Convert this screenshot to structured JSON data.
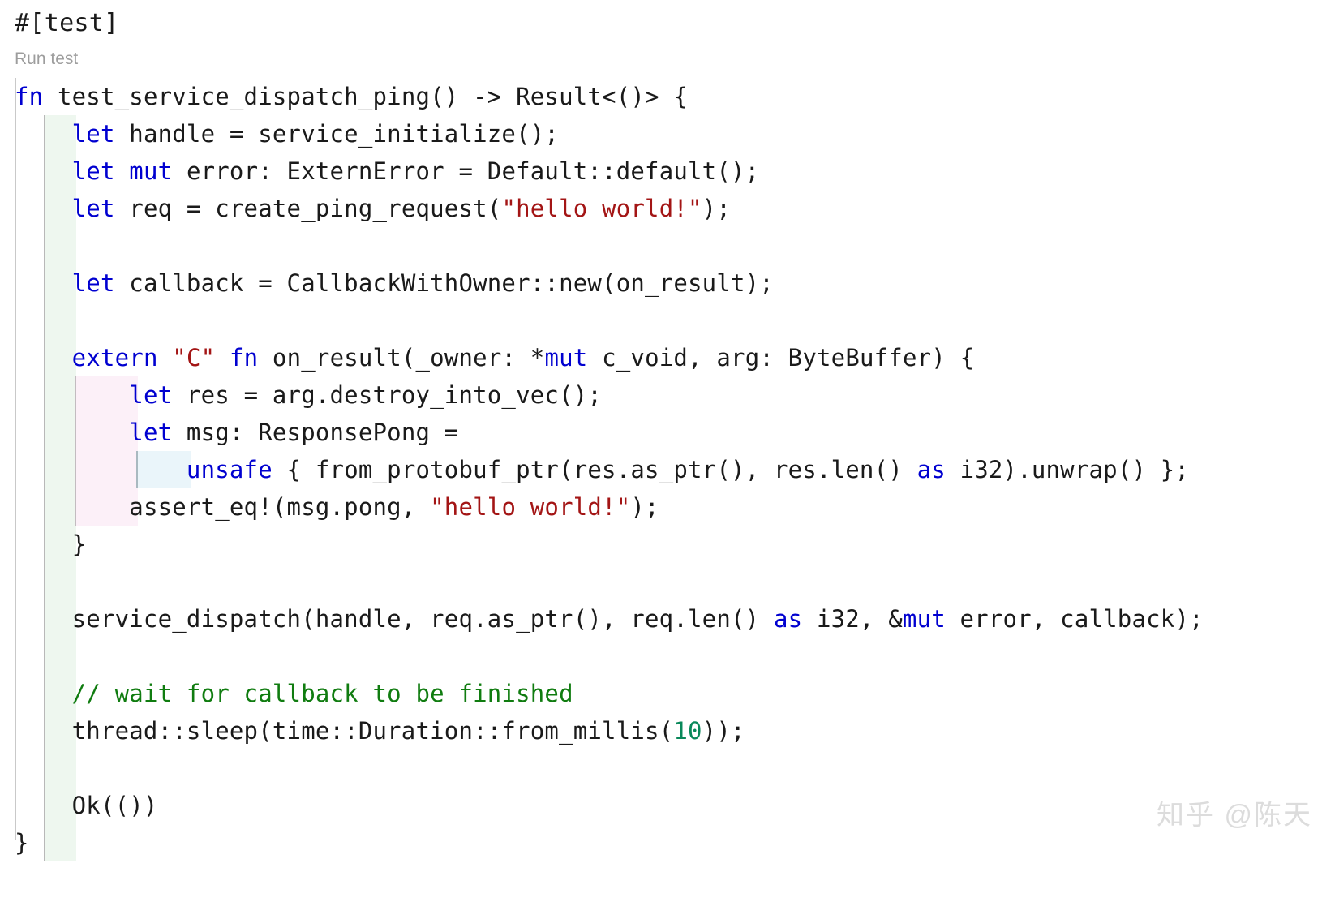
{
  "editor": {
    "attribute": "#[test]",
    "codelens": "Run test",
    "language": "rust"
  },
  "colors": {
    "keyword": "#0000d0",
    "string": "#a31515",
    "comment": "#107c10",
    "number": "#09885a",
    "text": "#1a1a1a",
    "codelens": "#9d9d9d",
    "scope_level1_bg": "#eef7ef",
    "scope_level2_bg": "#fcf0f8",
    "scope_level3_bg": "#eaf5fa",
    "watermark": "#dcdcdc",
    "background": "#ffffff"
  },
  "code": {
    "lines": [
      {
        "id": "line-fn-signature",
        "tokens": [
          {
            "t": "fn",
            "c": "kw"
          },
          {
            "t": " test_service_dispatch_ping() -> Result<()> {",
            "c": "plain"
          }
        ]
      },
      {
        "id": "line-let-handle",
        "tokens": [
          {
            "t": "    ",
            "c": "plain"
          },
          {
            "t": "let",
            "c": "kw"
          },
          {
            "t": " handle = service_initialize();",
            "c": "plain"
          }
        ]
      },
      {
        "id": "line-let-mut-error",
        "tokens": [
          {
            "t": "    ",
            "c": "plain"
          },
          {
            "t": "let",
            "c": "kw"
          },
          {
            "t": " ",
            "c": "plain"
          },
          {
            "t": "mut",
            "c": "kw"
          },
          {
            "t": " error: ExternError = Default::default();",
            "c": "plain"
          }
        ]
      },
      {
        "id": "line-let-req",
        "tokens": [
          {
            "t": "    ",
            "c": "plain"
          },
          {
            "t": "let",
            "c": "kw"
          },
          {
            "t": " req = create_ping_request(",
            "c": "plain"
          },
          {
            "t": "\"hello world!\"",
            "c": "str"
          },
          {
            "t": ");",
            "c": "plain"
          }
        ]
      },
      {
        "id": "line-blank-1",
        "tokens": [
          {
            "t": "",
            "c": "plain"
          }
        ]
      },
      {
        "id": "line-let-callback",
        "tokens": [
          {
            "t": "    ",
            "c": "plain"
          },
          {
            "t": "let",
            "c": "kw"
          },
          {
            "t": " callback = CallbackWithOwner::new(on_result);",
            "c": "plain"
          }
        ]
      },
      {
        "id": "line-blank-2",
        "tokens": [
          {
            "t": "",
            "c": "plain"
          }
        ]
      },
      {
        "id": "line-extern-fn",
        "tokens": [
          {
            "t": "    ",
            "c": "plain"
          },
          {
            "t": "extern",
            "c": "kw"
          },
          {
            "t": " ",
            "c": "plain"
          },
          {
            "t": "\"C\"",
            "c": "str"
          },
          {
            "t": " ",
            "c": "plain"
          },
          {
            "t": "fn",
            "c": "kw"
          },
          {
            "t": " on_result(_owner: *",
            "c": "plain"
          },
          {
            "t": "mut",
            "c": "kw"
          },
          {
            "t": " c_void, arg: ByteBuffer) {",
            "c": "plain"
          }
        ]
      },
      {
        "id": "line-let-res",
        "tokens": [
          {
            "t": "        ",
            "c": "plain"
          },
          {
            "t": "let",
            "c": "kw"
          },
          {
            "t": " res = arg.destroy_into_vec();",
            "c": "plain"
          }
        ]
      },
      {
        "id": "line-let-msg",
        "tokens": [
          {
            "t": "        ",
            "c": "plain"
          },
          {
            "t": "let",
            "c": "kw"
          },
          {
            "t": " msg: ResponsePong =",
            "c": "plain"
          }
        ]
      },
      {
        "id": "line-unsafe-block",
        "tokens": [
          {
            "t": "            ",
            "c": "plain"
          },
          {
            "t": "unsafe",
            "c": "kw"
          },
          {
            "t": " { from_protobuf_ptr(res.as_ptr(), res.len() ",
            "c": "plain"
          },
          {
            "t": "as",
            "c": "kw"
          },
          {
            "t": " i32).unwrap() };",
            "c": "plain"
          }
        ]
      },
      {
        "id": "line-assert-eq",
        "tokens": [
          {
            "t": "        ",
            "c": "plain"
          },
          {
            "t": "assert_eq!(msg.pong, ",
            "c": "plain"
          },
          {
            "t": "\"hello world!\"",
            "c": "str"
          },
          {
            "t": ");",
            "c": "plain"
          }
        ]
      },
      {
        "id": "line-close-extern",
        "tokens": [
          {
            "t": "    }",
            "c": "plain"
          }
        ]
      },
      {
        "id": "line-blank-3",
        "tokens": [
          {
            "t": "",
            "c": "plain"
          }
        ]
      },
      {
        "id": "line-service-dispatch",
        "tokens": [
          {
            "t": "    service_dispatch(handle, req.as_ptr(), req.len() ",
            "c": "plain"
          },
          {
            "t": "as",
            "c": "kw"
          },
          {
            "t": " i32, &",
            "c": "plain"
          },
          {
            "t": "mut",
            "c": "kw"
          },
          {
            "t": " error, callback);",
            "c": "plain"
          }
        ]
      },
      {
        "id": "line-blank-4",
        "tokens": [
          {
            "t": "",
            "c": "plain"
          }
        ]
      },
      {
        "id": "line-comment-wait",
        "tokens": [
          {
            "t": "    ",
            "c": "plain"
          },
          {
            "t": "// wait for callback to be finished",
            "c": "cmt"
          }
        ]
      },
      {
        "id": "line-thread-sleep",
        "tokens": [
          {
            "t": "    thread::sleep(time::Duration::from_millis(",
            "c": "plain"
          },
          {
            "t": "10",
            "c": "num"
          },
          {
            "t": "));",
            "c": "plain"
          }
        ]
      },
      {
        "id": "line-blank-5",
        "tokens": [
          {
            "t": "",
            "c": "plain"
          }
        ]
      },
      {
        "id": "line-ok-return",
        "tokens": [
          {
            "t": "    Ok(())",
            "c": "plain"
          }
        ]
      },
      {
        "id": "line-close-fn",
        "tokens": [
          {
            "t": "}",
            "c": "plain"
          }
        ]
      }
    ],
    "scopes": [
      {
        "level": 1,
        "from": 1,
        "to": 20,
        "name": "fn-body-scope"
      },
      {
        "level": 2,
        "from": 8,
        "to": 11,
        "name": "extern-fn-body-scope"
      },
      {
        "level": 3,
        "from": 10,
        "to": 10,
        "name": "unsafe-block-scope"
      }
    ]
  },
  "watermark": {
    "text": "知乎 @陈天"
  }
}
